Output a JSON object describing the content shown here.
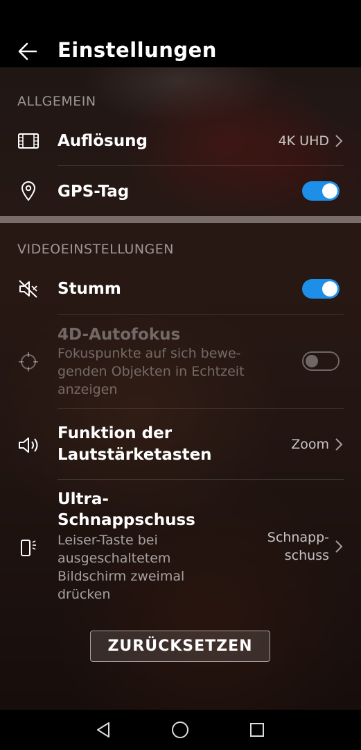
{
  "header": {
    "title": "Einstellungen"
  },
  "sections": {
    "general": {
      "title": "ALLGEMEIN"
    },
    "video": {
      "title": "VIDEOEINSTELLUNGEN"
    }
  },
  "settings": {
    "resolution": {
      "label": "Auflösung",
      "value": "4K UHD"
    },
    "gps_tag": {
      "label": "GPS-Tag",
      "enabled": true
    },
    "mute": {
      "label": "Stumm",
      "enabled": true
    },
    "autofocus_4d": {
      "label": "4D-Autofokus",
      "sub_lines": [
        "Fokuspunkte auf sich bewe-",
        "genden Objekten in Echtzeit",
        "anzeigen"
      ],
      "enabled": false,
      "disabled": true
    },
    "volume_keys": {
      "label_lines": [
        "Funktion der",
        "Lautstärketasten"
      ],
      "value": "Zoom"
    },
    "ultra_snapshot": {
      "label_lines": [
        "Ultra-",
        "Schnappschuss"
      ],
      "sub_lines": [
        "Leiser-Taste bei",
        "ausgeschaltetem",
        "Bildschirm zweimal",
        "drücken"
      ],
      "value_lines": [
        "Schnapp-",
        "schuss"
      ]
    }
  },
  "reset_button": {
    "label": "ZURÜCKSETZEN"
  },
  "colors": {
    "accent": "#1e8fe8",
    "background": "#000000"
  },
  "navbar": {
    "icons": [
      "back-triangle-icon",
      "home-circle-icon",
      "recents-square-icon"
    ]
  }
}
